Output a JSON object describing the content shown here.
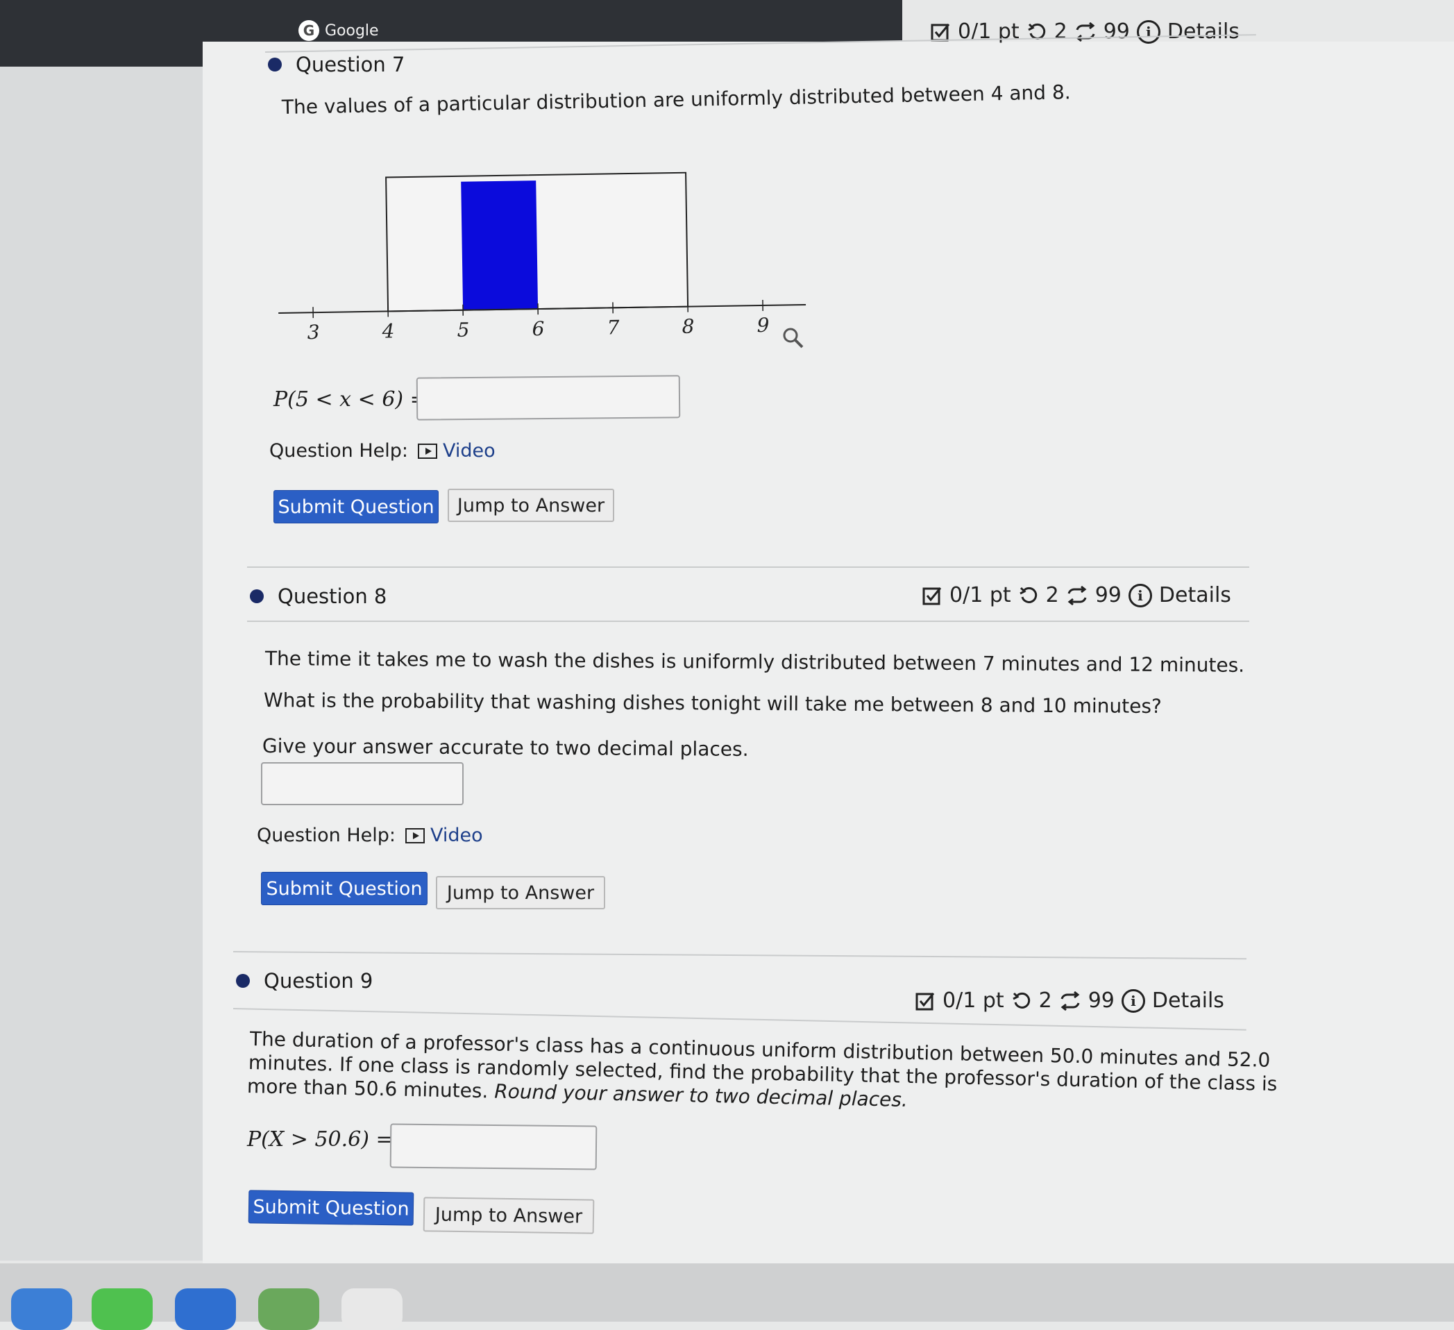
{
  "browser": {
    "tab_title": "Google",
    "logo_letter": "G"
  },
  "questions": [
    {
      "title": "Question 7",
      "meta": {
        "points": "0/1 pt",
        "retries": "2",
        "attempts": "99",
        "details": "Details"
      },
      "text": "The values of a particular distribution are uniformly distributed between 4 and 8.",
      "prob_label": "P(5 < x < 6) =",
      "help_label": "Question Help:",
      "video_label": "Video",
      "submit_label": "Submit Question",
      "jump_label": "Jump to Answer"
    },
    {
      "title": "Question 8",
      "meta": {
        "points": "0/1 pt",
        "retries": "2",
        "attempts": "99",
        "details": "Details"
      },
      "text1": "The time it takes me to wash the dishes is uniformly distributed between 7 minutes and 12 minutes.",
      "text2": "What is the probability that washing dishes tonight will take me between 8 and 10 minutes?",
      "text3": "Give your answer accurate to two decimal places.",
      "help_label": "Question Help:",
      "video_label": "Video",
      "submit_label": "Submit Question",
      "jump_label": "Jump to Answer"
    },
    {
      "title": "Question 9",
      "meta": {
        "points": "0/1 pt",
        "retries": "2",
        "attempts": "99",
        "details": "Details"
      },
      "line1": "The duration of a professor's class has a continuous uniform distribution between 50.0 minutes and 52.0",
      "line2": "minutes. If one class is randomly selected, find the probability that the professor's duration of the class is",
      "line3_plain": "more than 50.6 minutes. ",
      "line3_italic": "Round your answer to two decimal places.",
      "prob_label": "P(X > 50.6) =",
      "submit_label": "Submit Question",
      "jump_label": "Jump to Answer"
    }
  ],
  "chart_data": {
    "type": "area",
    "x_ticks": [
      "3",
      "4",
      "5",
      "6",
      "7",
      "8",
      "9"
    ],
    "xlim": [
      3,
      9
    ],
    "distribution_range": [
      4,
      8
    ],
    "shaded_range": [
      5,
      6
    ],
    "shade_color": "#0b0bdc"
  },
  "colors": {
    "primary_button": "#2b5fc5",
    "bullet": "#1a2a66",
    "link": "#1d3f8a"
  }
}
